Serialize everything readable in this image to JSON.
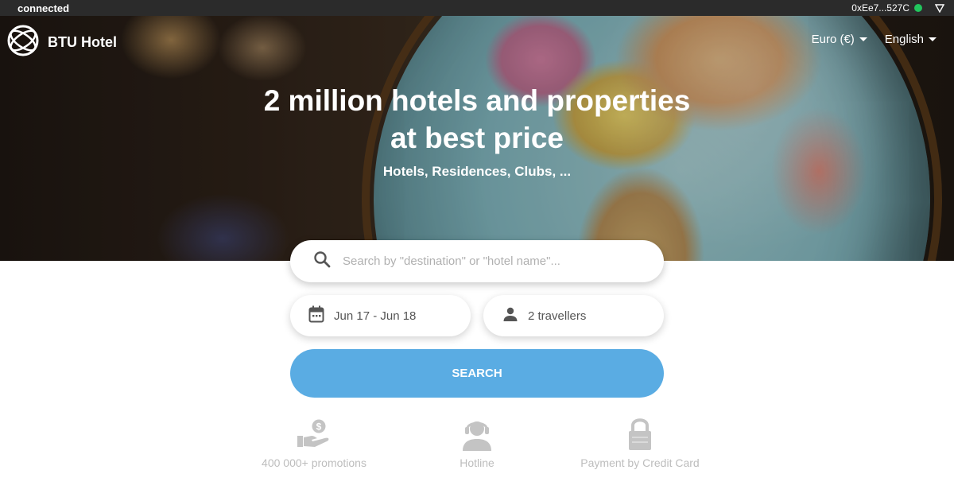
{
  "status_bar": {
    "state": "connected",
    "wallet_address": "0xEe7...527C"
  },
  "header": {
    "brand": "BTU Hotel",
    "currency": "Euro (€)",
    "language": "English"
  },
  "hero": {
    "title_line1": "2 million hotels and properties",
    "title_line2": "at best price",
    "subtitle": "Hotels, Residences, Clubs, ..."
  },
  "search": {
    "placeholder": "Search by \"destination\" or \"hotel name\"...",
    "dates": "Jun 17 - Jun 18",
    "travellers": "2 travellers",
    "button_label": "SEARCH"
  },
  "features": [
    {
      "label": "400 000+ promotions",
      "icon": "hand-money-icon"
    },
    {
      "label": "Hotline",
      "icon": "headset-icon"
    },
    {
      "label": "Payment by Credit Card",
      "icon": "lock-icon"
    }
  ],
  "colors": {
    "primary_button": "#5aace3",
    "status_bar": "#2b2b2b",
    "connected_dot": "#21c55d",
    "feature_grey": "#bdbdbd"
  }
}
